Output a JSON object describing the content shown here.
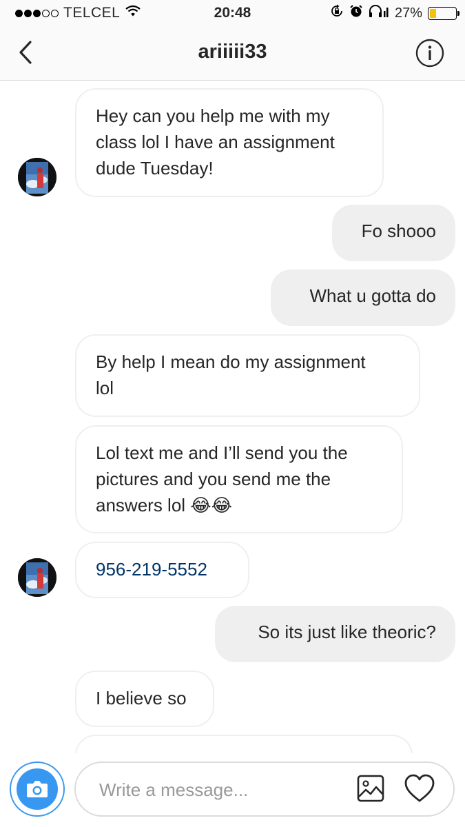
{
  "status_bar": {
    "carrier": "TELCEL",
    "time": "20:48",
    "battery": "27%",
    "battery_level": 0.27,
    "signal_bars": 3,
    "signal_total": 5,
    "icons": [
      "wifi-icon",
      "orientation-lock-icon",
      "alarm-icon",
      "headphones-icon",
      "battery-icon"
    ]
  },
  "header": {
    "title": "ariiiii33",
    "back_icon": "chevron-left-icon",
    "info_icon": "info-icon"
  },
  "messages": [
    {
      "from": "them",
      "lines": [
        "Hey can you help me with my",
        "class lol I have an assignment",
        "dude Tuesday!"
      ]
    },
    {
      "from": "me",
      "lines": [
        "Fo shooo"
      ]
    },
    {
      "from": "me",
      "lines": [
        "What u gotta do"
      ]
    },
    {
      "from": "them",
      "lines": [
        "By help I mean do my assignment",
        "lol"
      ]
    },
    {
      "from": "them",
      "lines": [
        "Lol text me and I’ll send you the",
        "pictures and you send me the",
        "answers lol 😂😂"
      ]
    },
    {
      "from": "them",
      "lines": [
        "956-219-5552"
      ]
    },
    {
      "from": "me",
      "lines": [
        "So its just like theoric?"
      ]
    },
    {
      "from": "them",
      "lines": [
        "I believe so"
      ]
    }
  ],
  "composer": {
    "placeholder": "Write a message...",
    "camera_icon": "camera-icon",
    "gallery_icon": "gallery-icon",
    "heart_icon": "heart-icon"
  },
  "colors": {
    "accent": "#3897f0",
    "link": "#003569",
    "outgoing_bubble": "#efefef",
    "incoming_border": "#efefef",
    "battery": "#f4c20d"
  }
}
